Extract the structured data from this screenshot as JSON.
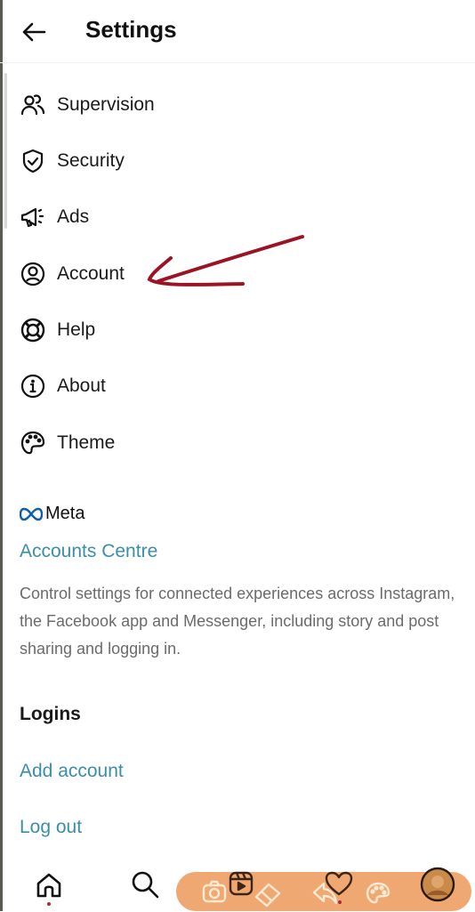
{
  "header": {
    "title": "Settings",
    "back_icon": "arrow-left-icon"
  },
  "menu": [
    {
      "label": "Supervision",
      "icon": "supervision-icon"
    },
    {
      "label": "Security",
      "icon": "shield-check-icon"
    },
    {
      "label": "Ads",
      "icon": "megaphone-icon"
    },
    {
      "label": "Account",
      "icon": "account-circle-icon"
    },
    {
      "label": "Help",
      "icon": "lifebuoy-icon"
    },
    {
      "label": "About",
      "icon": "info-icon"
    },
    {
      "label": "Theme",
      "icon": "palette-icon"
    }
  ],
  "meta": {
    "brand": "Meta",
    "accounts_centre": "Accounts Centre",
    "description": "Control settings for connected experiences across Instagram, the Facebook app and Messenger, including story and post sharing and logging in."
  },
  "logins": {
    "heading": "Logins",
    "add_account": "Add account",
    "log_out": "Log out"
  },
  "bottom_nav": {
    "items": [
      "home-icon",
      "search-icon",
      "camera-icon",
      "reels-icon",
      "eraser-icon",
      "share-icon",
      "heart-icon",
      "palette-icon",
      "profile-avatar"
    ]
  },
  "colors": {
    "accent_link": "#3a8fa8",
    "annotation_arrow": "#9b1424",
    "overlay_pill": "#f0a872"
  }
}
